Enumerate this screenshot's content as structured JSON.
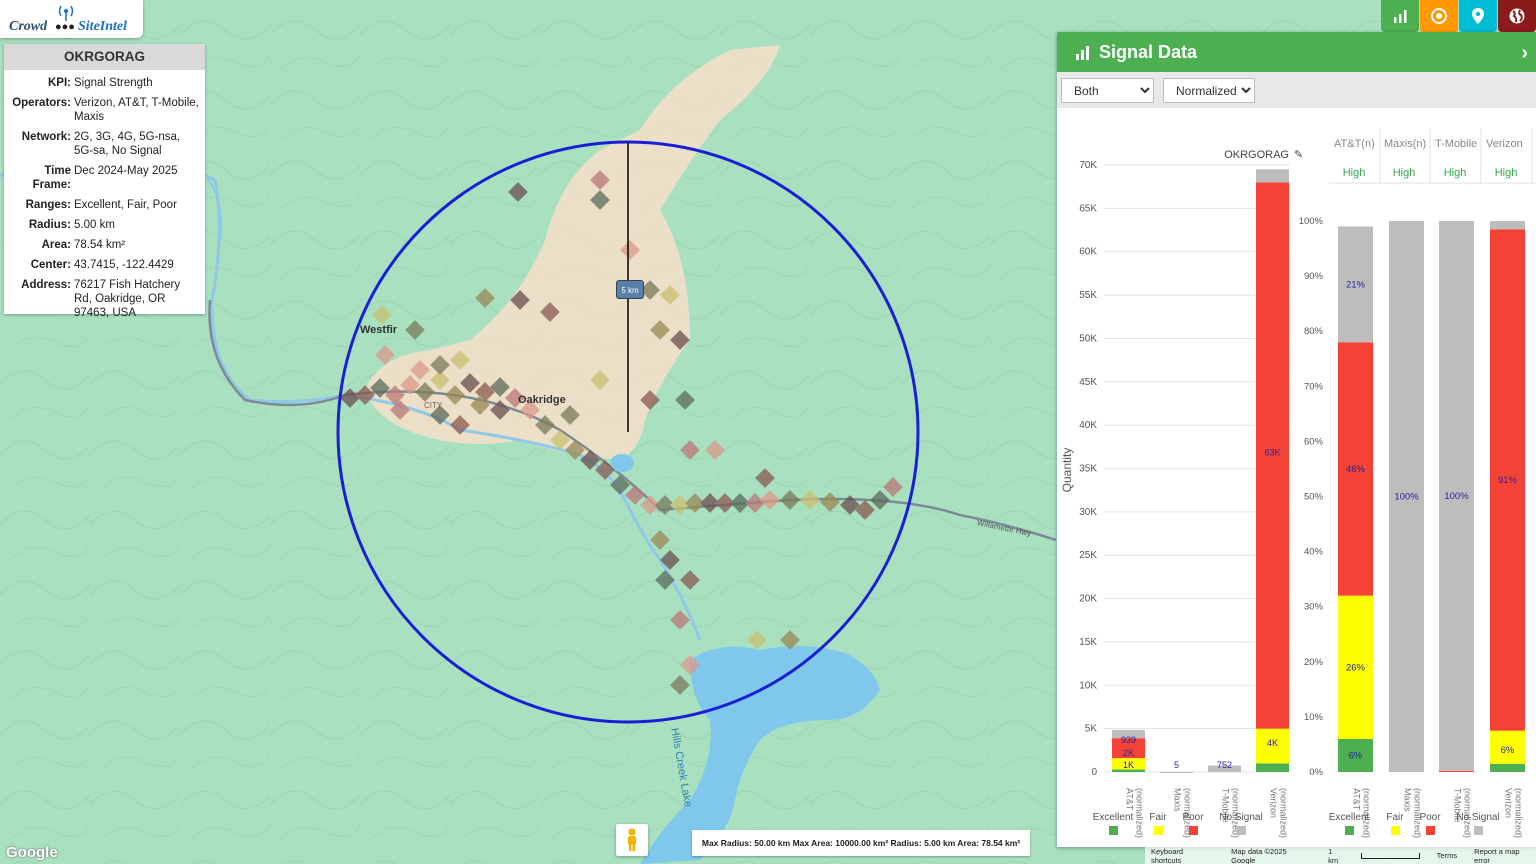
{
  "logo": {
    "word1": "Crowd",
    "word2": "SiteIntel"
  },
  "info": {
    "title": "OKRGORAG",
    "rows": [
      {
        "k": "KPI:",
        "v": "Signal Strength"
      },
      {
        "k": "Operators:",
        "v": "Verizon, AT&T, T-Mobile, Maxis"
      },
      {
        "k": "Network:",
        "v": "2G, 3G, 4G, 5G-nsa, 5G-sa, No Signal"
      },
      {
        "k": "Time Frame:",
        "v": "Dec 2024-May 2025"
      },
      {
        "k": "Ranges:",
        "v": "Excellent, Fair, Poor"
      },
      {
        "k": "Radius:",
        "v": "5.00 km"
      },
      {
        "k": "Area:",
        "v": "78.54 km²"
      },
      {
        "k": "Center:",
        "v": "43.7415, -122.4429"
      },
      {
        "k": "Address:",
        "v": "76217 Fish Hatchery Rd, Oakridge, OR 97463, USA"
      }
    ]
  },
  "map": {
    "labels": {
      "westfir": "Westfir",
      "oakridge": "Oakridge",
      "hills_creek": "Hills Creek Lake",
      "highway": "Willamette Hwy",
      "city": "CITY",
      "radius_tag": "5 km"
    },
    "google": "Google"
  },
  "panel": {
    "title": "Signal Data",
    "select1": "Both",
    "select2": "Normalized",
    "chart_title": "OKRGORAG"
  },
  "chart_data": [
    {
      "type": "bar",
      "stacked": true,
      "title": "OKRGORAG",
      "ylabel": "Quantity",
      "ylim": [
        0,
        70000
      ],
      "yticks": [
        "0",
        "5K",
        "10K",
        "15K",
        "20K",
        "25K",
        "30K",
        "35K",
        "40K",
        "45K",
        "50K",
        "55K",
        "60K",
        "65K",
        "70K"
      ],
      "categories": [
        "AT&T (normalized)",
        "Maxis (normalized)",
        "T-Mobile (normalized)",
        "Verizon (normalized)"
      ],
      "series": [
        {
          "name": "Excellent",
          "color": "#4caf50",
          "values": [
            300,
            0,
            0,
            1000
          ]
        },
        {
          "name": "Fair",
          "color": "#ffff00",
          "values": [
            1300,
            0,
            0,
            4000
          ]
        },
        {
          "name": "Poor",
          "color": "#f44336",
          "values": [
            2300,
            0,
            0,
            63000
          ]
        },
        {
          "name": "No Signal",
          "color": "#bdbdbd",
          "values": [
            939,
            5,
            752,
            1500
          ]
        }
      ],
      "labels": [
        {
          "cat": 0,
          "series": 1,
          "text": "1K"
        },
        {
          "cat": 0,
          "series": 2,
          "text": "2K"
        },
        {
          "cat": 0,
          "series": 3,
          "text": "939"
        },
        {
          "cat": 1,
          "series": 3,
          "text": "5"
        },
        {
          "cat": 2,
          "series": 3,
          "text": "752"
        },
        {
          "cat": 3,
          "series": 1,
          "text": "4K"
        },
        {
          "cat": 3,
          "series": 2,
          "text": "63K"
        }
      ],
      "legend": "bottom"
    },
    {
      "type": "bar",
      "stacked": true,
      "percent": true,
      "ylim": [
        0,
        100
      ],
      "yticks": [
        "0%",
        "10%",
        "20%",
        "30%",
        "40%",
        "50%",
        "60%",
        "70%",
        "80%",
        "90%",
        "100%"
      ],
      "headers": [
        "AT&T(n)",
        "Maxis(n)",
        "T-Mobile",
        "Verizon"
      ],
      "header_values": [
        "High",
        "High",
        "High",
        "High"
      ],
      "categories": [
        "AT&T (normalized)",
        "Maxis (normalized)",
        "T-Mobile (normalized)",
        "Verizon (normalized)"
      ],
      "series": [
        {
          "name": "Excellent",
          "color": "#4caf50",
          "values": [
            6,
            0,
            0,
            1.5
          ]
        },
        {
          "name": "Fair",
          "color": "#ffff00",
          "values": [
            26,
            0,
            0,
            6
          ]
        },
        {
          "name": "Poor",
          "color": "#f44336",
          "values": [
            46,
            0,
            0.2,
            91
          ]
        },
        {
          "name": "No Signal",
          "color": "#bdbdbd",
          "values": [
            21,
            100,
            99.8,
            1.5
          ]
        }
      ],
      "labels": [
        {
          "cat": 0,
          "series": 0,
          "text": "6%"
        },
        {
          "cat": 0,
          "series": 1,
          "text": "26%"
        },
        {
          "cat": 0,
          "series": 2,
          "text": "46%"
        },
        {
          "cat": 0,
          "series": 3,
          "text": "21%"
        },
        {
          "cat": 1,
          "series": 3,
          "text": "100%"
        },
        {
          "cat": 2,
          "series": 3,
          "text": "100%"
        },
        {
          "cat": 3,
          "series": 1,
          "text": "6%"
        },
        {
          "cat": 3,
          "series": 2,
          "text": "91%"
        }
      ],
      "legend": "bottom"
    }
  ],
  "bottom_info": {
    "text": "Max Radius: 50.00 km Max Area: 10000.00 km² Radius: 5.00 km Area: 78.54 km²"
  },
  "attribution": [
    "Keyboard shortcuts",
    "Map data ©2025 Google",
    "1 km",
    "Terms",
    "Report a map error"
  ],
  "top_buttons": [
    {
      "name": "chart-icon",
      "color": "#4caf50"
    },
    {
      "name": "target-icon",
      "color": "#ff9800"
    },
    {
      "name": "pin-icon",
      "color": "#00bcd4"
    },
    {
      "name": "globe-icon",
      "color": "#8b1a1a"
    }
  ]
}
